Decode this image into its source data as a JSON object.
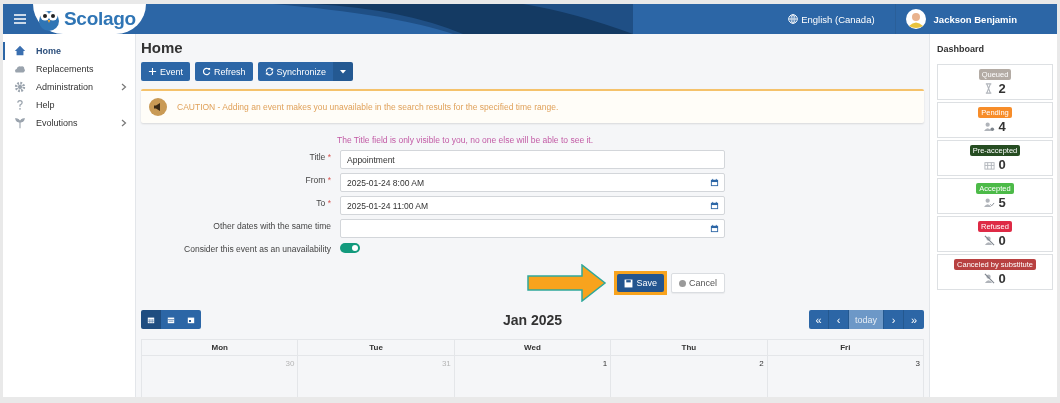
{
  "header": {
    "logo": "Scolago",
    "language": "English (Canada)",
    "user": "Jackson Benjamin"
  },
  "sidebar": {
    "items": [
      {
        "label": "Home",
        "selected": true,
        "has_submenu": false
      },
      {
        "label": "Replacements",
        "selected": false,
        "has_submenu": false
      },
      {
        "label": "Administration",
        "selected": false,
        "has_submenu": true
      },
      {
        "label": "Help",
        "selected": false,
        "has_submenu": false
      },
      {
        "label": "Evolutions",
        "selected": false,
        "has_submenu": true
      }
    ]
  },
  "page": {
    "title": "Home",
    "toolbar": [
      {
        "label": "Event",
        "dropdown": false
      },
      {
        "label": "Refresh",
        "dropdown": false
      },
      {
        "label": "Synchronize",
        "dropdown": true
      }
    ],
    "caution": "CAUTION - Adding an event makes you unavailable in the search results for the specified time range.",
    "form": {
      "note": "The Title field is only visible to you, no one else will be able to see it.",
      "fields": [
        {
          "label": "Title",
          "required_mark": "*",
          "kind": "text",
          "value": "Appointment"
        },
        {
          "label": "From",
          "required_mark": "*",
          "kind": "date",
          "value": "2025-01-24 8:00 AM"
        },
        {
          "label": "To",
          "required_mark": "*",
          "kind": "date",
          "value": "2025-01-24 11:00 AM"
        },
        {
          "label": "Other dates with the same time",
          "kind": "date"
        }
      ],
      "toggle": {
        "label": "Consider this event as an unavailability",
        "on": true
      },
      "buttons": [
        {
          "label": "Save",
          "kind": "primary",
          "highlighted": true
        },
        {
          "label": "Cancel",
          "kind": "secondary",
          "highlighted": false
        }
      ]
    },
    "calendar": {
      "title": "Jan 2025",
      "views": [
        {
          "selected": true
        },
        {
          "selected": false
        },
        {
          "selected": false
        }
      ],
      "nav": [
        {
          "label": "«",
          "disabled": false
        },
        {
          "label": "‹",
          "disabled": false
        },
        {
          "label": "today",
          "disabled": true
        },
        {
          "label": "›",
          "disabled": false
        },
        {
          "label": "»",
          "disabled": false
        }
      ],
      "days": [
        "Mon",
        "Tue",
        "Wed",
        "Thu",
        "Fri"
      ],
      "dates": [
        {
          "label": "30",
          "other_month": true
        },
        {
          "label": "31",
          "other_month": true
        },
        {
          "label": "1",
          "other_month": false
        },
        {
          "label": "2",
          "other_month": false
        },
        {
          "label": "3",
          "other_month": false
        }
      ]
    }
  },
  "dashboard": {
    "title": "Dashboard",
    "cards": [
      {
        "label": "Queued",
        "count": "2",
        "color": "#b3aba4"
      },
      {
        "label": "Pending",
        "count": "4",
        "color": "#f78d2a"
      },
      {
        "label": "Pre-accepted",
        "count": "0",
        "color": "#264d22"
      },
      {
        "label": "Accepted",
        "count": "5",
        "color": "#4cba48"
      },
      {
        "label": "Refused",
        "count": "0",
        "color": "#de2a45"
      },
      {
        "label": "Canceled by substitute",
        "count": "0",
        "color": "#b84141"
      }
    ]
  }
}
